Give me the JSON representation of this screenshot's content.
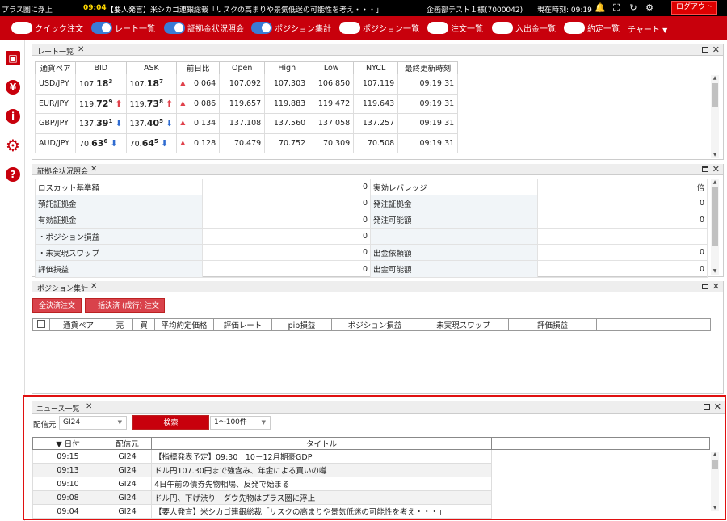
{
  "ticker": {
    "prev_text": "プラス圏に浮上",
    "time": "09:04",
    "message": "【要人発言】米シカゴ連銀総裁「リスクの高まりや景気低迷の可能性を考え・・・」"
  },
  "user": {
    "name": "企画部テスト１様(7000042)",
    "clock_label": "現在時刻: 09:19",
    "logout": "ログアウト"
  },
  "menu": {
    "items": [
      {
        "label": "クイック注文",
        "on": false
      },
      {
        "label": "レート一覧",
        "on": true
      },
      {
        "label": "証拠金状況照会",
        "on": true
      },
      {
        "label": "ポジション集計",
        "on": true
      },
      {
        "label": "ポジション一覧",
        "on": false
      },
      {
        "label": "注文一覧",
        "on": false
      },
      {
        "label": "入出金一覧",
        "on": false
      },
      {
        "label": "約定一覧",
        "on": false
      }
    ],
    "chart": "チャート"
  },
  "colors": {
    "brand_red": "#c8000c",
    "toggle_on": "#3a7bd5",
    "up": "#e0404a",
    "down": "#2f6bd0"
  },
  "rate_panel": {
    "title": "レート一覧",
    "headers": [
      "通貨ペア",
      "BID",
      "ASK",
      "前日比",
      "Open",
      "High",
      "Low",
      "NYCL",
      "最終更新時刻"
    ],
    "rows": [
      {
        "pair": "USD/JPY",
        "bid_pre": "107.",
        "bid_big": "18",
        "bid_sup": "3",
        "bid_dir": "",
        "ask_pre": "107.",
        "ask_big": "18",
        "ask_sup": "7",
        "ask_dir": "",
        "chg": "0.064",
        "open": "107.092",
        "high": "107.303",
        "low": "106.850",
        "nycl": "107.119",
        "time": "09:19:31"
      },
      {
        "pair": "EUR/JPY",
        "bid_pre": "119.",
        "bid_big": "72",
        "bid_sup": "9",
        "bid_dir": "up",
        "ask_pre": "119.",
        "ask_big": "73",
        "ask_sup": "8",
        "ask_dir": "up",
        "chg": "0.086",
        "open": "119.657",
        "high": "119.883",
        "low": "119.472",
        "nycl": "119.643",
        "time": "09:19:31"
      },
      {
        "pair": "GBP/JPY",
        "bid_pre": "137.",
        "bid_big": "39",
        "bid_sup": "1",
        "bid_dir": "down",
        "ask_pre": "137.",
        "ask_big": "40",
        "ask_sup": "5",
        "ask_dir": "down",
        "chg": "0.134",
        "open": "137.108",
        "high": "137.560",
        "low": "137.058",
        "nycl": "137.257",
        "time": "09:19:31"
      },
      {
        "pair": "AUD/JPY",
        "bid_pre": "70.",
        "bid_big": "63",
        "bid_sup": "6",
        "bid_dir": "down",
        "ask_pre": "70.",
        "ask_big": "64",
        "ask_sup": "5",
        "ask_dir": "down",
        "chg": "0.128",
        "open": "70.479",
        "high": "70.752",
        "low": "70.309",
        "nycl": "70.508",
        "time": "09:19:31"
      }
    ]
  },
  "margin_panel": {
    "title": "証拠金状況照会",
    "rows": [
      {
        "l1": "ロスカット基準額",
        "v1": "0",
        "l2": "実効レバレッジ",
        "v2": "倍"
      },
      {
        "l1": "預託証拠金",
        "v1": "0",
        "l2": "発注証拠金",
        "v2": "0"
      },
      {
        "l1": "有効証拠金",
        "v1": "0",
        "l2": "発注可能額",
        "v2": "0"
      },
      {
        "l1": "・ポジション損益",
        "v1": "0",
        "l2": "",
        "v2": ""
      },
      {
        "l1": "・未実現スワップ",
        "v1": "0",
        "l2": "出金依頼額",
        "v2": "0"
      },
      {
        "l1": "評価損益",
        "v1": "0",
        "l2": "出金可能額",
        "v2": "0"
      }
    ]
  },
  "position_panel": {
    "title": "ポジション集計",
    "btn_all_close": "全決済注文",
    "btn_bulk_close": "一括決済 (成行) 注文",
    "headers": [
      "通貨ペア",
      "売",
      "買",
      "平均約定価格",
      "評価レート",
      "pip損益",
      "ポジション損益",
      "未実現スワップ",
      "評価損益"
    ]
  },
  "news_panel": {
    "title": "ニュース一覧",
    "source_label": "配信元",
    "source_value": "GI24",
    "search": "検索",
    "range_value": "1～100件",
    "headers": [
      "▼ 日付",
      "配信元",
      "タイトル"
    ],
    "rows": [
      {
        "time": "09:15",
        "src": "GI24",
        "title": "【指標発表予定】09:30　10－12月期豪GDP"
      },
      {
        "time": "09:13",
        "src": "GI24",
        "title": "ドル円107.30円まで強含み、年金による買いの噂"
      },
      {
        "time": "09:10",
        "src": "GI24",
        "title": "4日午前の債券先物相場、反発で始まる"
      },
      {
        "time": "09:08",
        "src": "GI24",
        "title": "ドル円、下げ渋り　ダウ先物はプラス圏に浮上"
      },
      {
        "time": "09:04",
        "src": "GI24",
        "title": "【要人発言】米シカゴ連銀総裁「リスクの高まりや景気低迷の可能性を考え・・・」"
      }
    ]
  }
}
